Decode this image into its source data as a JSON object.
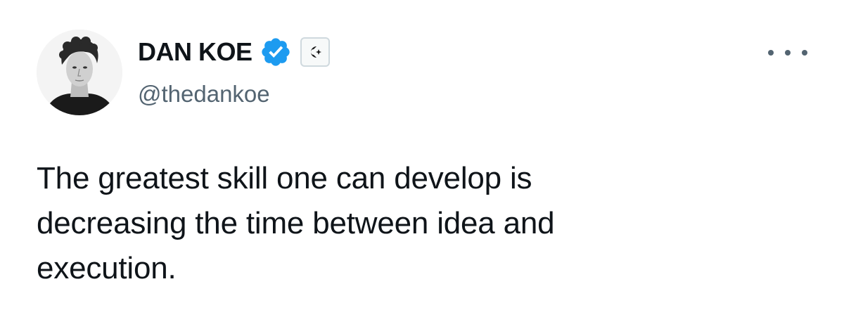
{
  "author": {
    "display_name": "DAN KOE",
    "handle": "@thedankoe",
    "avatar_icon": "avatar-photo",
    "verified_icon": "verified-badge-icon",
    "affiliate_icon": "affiliate-badge-icon"
  },
  "tweet": {
    "lines": [
      "The greatest skill one can develop is",
      "decreasing the time between idea and",
      "execution."
    ]
  },
  "actions": {
    "more_icon": "more-options-icon"
  },
  "colors": {
    "text_primary": "#0f1419",
    "text_secondary": "#536471",
    "verified_blue": "#1d9bf0",
    "background": "#ffffff"
  }
}
